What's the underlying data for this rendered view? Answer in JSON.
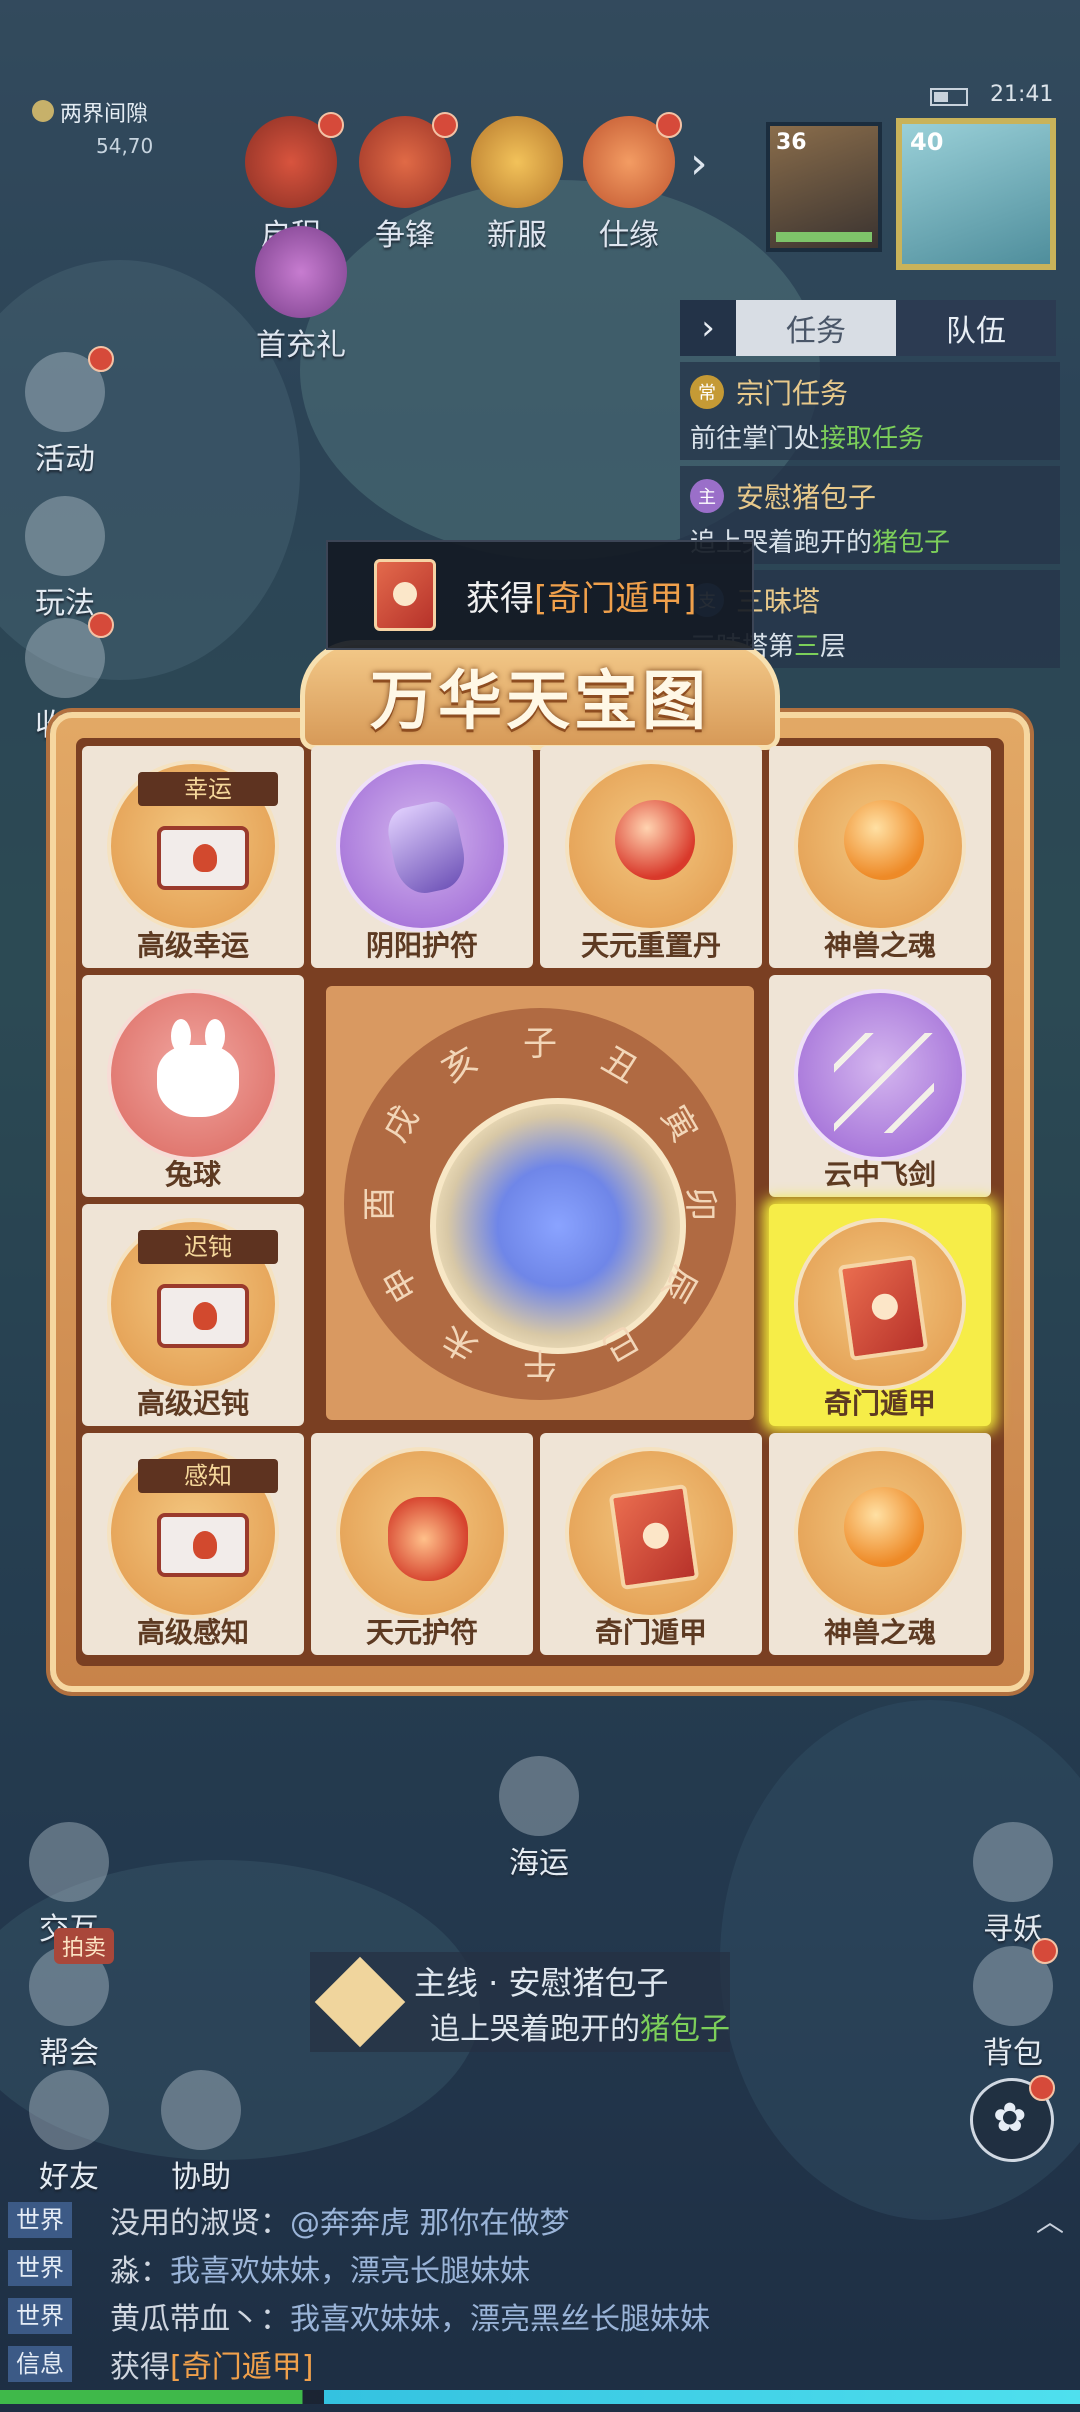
{
  "status": {
    "time": "21:41"
  },
  "region": {
    "name": "两界间隙",
    "coords": "54,70"
  },
  "top_icons": [
    {
      "label": "启程",
      "icon": "scroll-icon",
      "badge": true
    },
    {
      "label": "争锋",
      "icon": "flag-icon",
      "badge": true
    },
    {
      "label": "新服",
      "icon": "crown-icon",
      "badge": false
    },
    {
      "label": "仕缘",
      "icon": "heart-icon",
      "badge": true
    },
    {
      "label": "首充礼",
      "icon": "gift-icon",
      "badge": false
    }
  ],
  "portraits": {
    "pet_level": "36",
    "player_level": "40"
  },
  "task_panel": {
    "tabs": [
      "任务",
      "队伍"
    ],
    "active_tab": "任务",
    "items": [
      {
        "badge": "常",
        "title": "宗门任务",
        "desc_prefix": "前往掌门处",
        "desc_highlight": "接取任务",
        "desc_suffix": ""
      },
      {
        "badge": "主",
        "title": "安慰猪包子",
        "desc_prefix": "追上哭着跑开的",
        "desc_highlight": "猪包子",
        "desc_suffix": ""
      },
      {
        "badge": "支",
        "title": "三昧塔",
        "desc_prefix": "三昧塔第",
        "desc_highlight": "三",
        "desc_suffix": "层"
      }
    ]
  },
  "left_menu": [
    {
      "label": "活动",
      "badge": true
    },
    {
      "label": "玩法",
      "badge": false
    },
    {
      "label": "收益",
      "badge": true
    }
  ],
  "toast": {
    "prefix": "获得",
    "item": "[奇门遁甲]"
  },
  "treasure": {
    "title": "万华天宝图",
    "cells": [
      {
        "name": "高级幸运",
        "tag": "幸运",
        "style": "gold",
        "glyph": "scroll",
        "selected": false
      },
      {
        "name": "阴阳护符",
        "tag": "",
        "style": "purple",
        "glyph": "gem",
        "selected": false
      },
      {
        "name": "天元重置丹",
        "tag": "",
        "style": "gold",
        "glyph": "orb-red",
        "selected": false
      },
      {
        "name": "神兽之魂",
        "tag": "",
        "style": "gold",
        "glyph": "orb-orange",
        "selected": false
      },
      {
        "name": "兔球",
        "tag": "",
        "style": "pink",
        "glyph": "bunny",
        "selected": false
      },
      {
        "name": "云中飞剑",
        "tag": "",
        "style": "purple",
        "glyph": "swords",
        "selected": false
      },
      {
        "name": "高级迟钝",
        "tag": "迟钝",
        "style": "gold",
        "glyph": "scroll",
        "selected": false
      },
      {
        "name": "奇门遁甲",
        "tag": "",
        "style": "gold",
        "glyph": "book",
        "selected": true
      },
      {
        "name": "高级感知",
        "tag": "感知",
        "style": "gold",
        "glyph": "scroll",
        "selected": false
      },
      {
        "name": "天元护符",
        "tag": "",
        "style": "gold",
        "glyph": "amulet",
        "selected": false
      },
      {
        "name": "奇门遁甲",
        "tag": "",
        "style": "gold",
        "glyph": "book",
        "selected": false
      },
      {
        "name": "神兽之魂",
        "tag": "",
        "style": "gold",
        "glyph": "orb-orange",
        "selected": false
      }
    ],
    "compass_chars": [
      "子",
      "丑",
      "寅",
      "卯",
      "辰",
      "巳",
      "午",
      "未",
      "申",
      "酉",
      "戌",
      "亥"
    ]
  },
  "map_label": "海运",
  "bottom_left": [
    {
      "label": "交互"
    },
    {
      "label": "帮会",
      "tag": "拍卖"
    },
    {
      "label": "好友"
    },
    {
      "label": "协助"
    }
  ],
  "bottom_right": [
    {
      "label": "寻妖",
      "badge": false
    },
    {
      "label": "背包",
      "badge": true
    }
  ],
  "quest_tracker": {
    "title": "主线 · 安慰猪包子",
    "desc_prefix": "追上哭着跑开的",
    "desc_highlight": "猪包子"
  },
  "chat": [
    {
      "channel": "世界",
      "name": "没用的淑贤：",
      "text": "@奔奔虎 那你在做梦",
      "highlight": ""
    },
    {
      "channel": "世界",
      "name": "淼：",
      "text": "我喜欢妹妹，漂亮长腿妹妹",
      "highlight": ""
    },
    {
      "channel": "世界",
      "name": "黄瓜带血丶：",
      "text": "我喜欢妹妹，漂亮黑丝长腿妹妹",
      "highlight": ""
    },
    {
      "channel": "信息",
      "name": "",
      "text": "获得",
      "highlight": "[奇门遁甲]"
    }
  ],
  "colors": {
    "accent": "#f0a04b",
    "highlight_green": "#7ccf5a",
    "selected_cell": "#f6ed48",
    "panel": "#d79a58"
  }
}
